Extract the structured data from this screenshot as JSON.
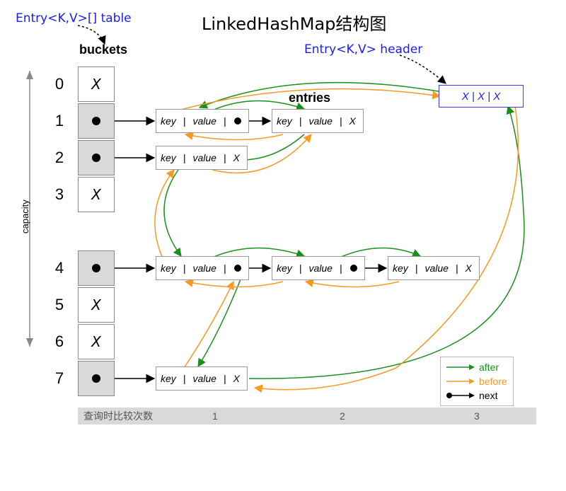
{
  "title": "LinkedHashMap结构图",
  "labels": {
    "table": "Entry<K,V>[] table",
    "header": "Entry<K,V> header",
    "buckets": "buckets",
    "entries": "entries",
    "capacity": "capacity",
    "footer": "查询时比较次数",
    "f1": "1",
    "f2": "2",
    "f3": "3"
  },
  "buckets": {
    "indices": [
      "0",
      "1",
      "2",
      "3",
      "4",
      "5",
      "6",
      "7"
    ],
    "cells": [
      "X",
      "●",
      "●",
      "X",
      "●",
      "X",
      "X",
      "●"
    ]
  },
  "entry_text": {
    "key": "key",
    "value": "value",
    "x": "X",
    "sep": "|",
    "header_cells": "X  |  X  |  X"
  },
  "legend": {
    "after": "after",
    "before": "before",
    "next": "next"
  },
  "colors": {
    "after": "#1a8f1a",
    "before": "#f59a22",
    "next": "#000000",
    "blue": "#1a1aff"
  },
  "chart_data": {
    "type": "diagram",
    "structure": "LinkedHashMap",
    "capacity": 8,
    "buckets": [
      {
        "index": 0,
        "chain": []
      },
      {
        "index": 1,
        "chain": [
          "e1",
          "e2"
        ]
      },
      {
        "index": 2,
        "chain": [
          "e3"
        ]
      },
      {
        "index": 3,
        "chain": []
      },
      {
        "index": 4,
        "chain": [
          "e4",
          "e5",
          "e6"
        ]
      },
      {
        "index": 5,
        "chain": []
      },
      {
        "index": 6,
        "chain": []
      },
      {
        "index": 7,
        "chain": [
          "e7"
        ]
      }
    ],
    "insertion_order_after_chain": [
      "header",
      "e1",
      "e2",
      "e3",
      "e4",
      "e5",
      "e6",
      "e7",
      "header"
    ],
    "legend": {
      "after": "green curved arrow",
      "before": "orange curved arrow",
      "next": "black straight arrow"
    }
  }
}
